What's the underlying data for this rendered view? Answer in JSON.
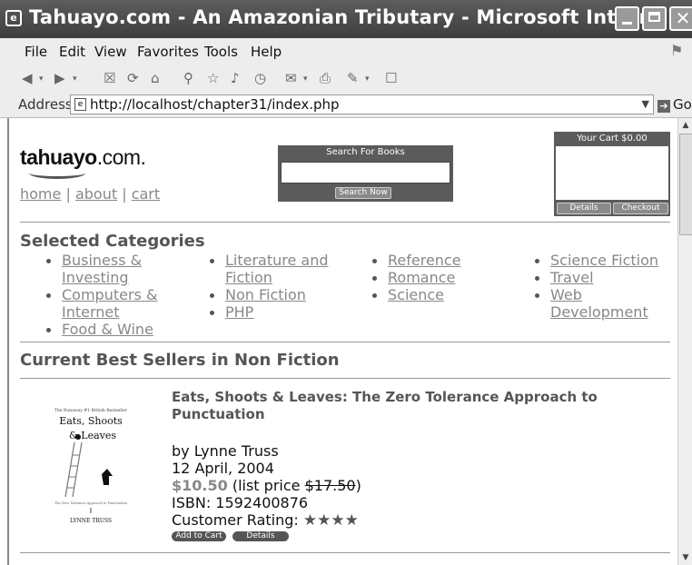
{
  "window": {
    "title": "Tahuayo.com - An Amazonian Tributary - Microsoft Intern..."
  },
  "menu": [
    "File",
    "Edit",
    "View",
    "Favorites",
    "Tools",
    "Help"
  ],
  "address": {
    "label": "Address",
    "url": "http://localhost/chapter31/index.php",
    "go_label": "Go"
  },
  "site": {
    "logo_bold": "tahuayo",
    "logo_rest": ".com.",
    "nav": [
      "home",
      "about",
      "cart"
    ],
    "nav_sep": "|",
    "search": {
      "header": "Search For Books",
      "button": "Search Now",
      "value": ""
    },
    "cart": {
      "header": "Your Cart $0.00",
      "details": "Details",
      "checkout": "Checkout"
    }
  },
  "categories": {
    "heading": "Selected Categories",
    "items": [
      [
        "Business &",
        "Investing"
      ],
      [
        "Computers &",
        "Internet"
      ],
      [
        "Food & Wine"
      ],
      [
        "Literature and",
        "Fiction"
      ],
      [
        "Non Fiction"
      ],
      [
        "PHP"
      ],
      [
        "Reference"
      ],
      [
        "Romance"
      ],
      [
        "Science"
      ],
      [
        "Science Fiction"
      ],
      [
        "Travel"
      ],
      [
        "Web",
        "Development"
      ]
    ]
  },
  "bestsellers": {
    "heading": "Current Best Sellers in Non Fiction",
    "book": {
      "title": "Eats, Shoots & Leaves: The Zero Tolerance Approach to Punctuation",
      "author": "by Lynne Truss",
      "date": "12 April, 2004",
      "price": "$10.50",
      "list_prefix": " (list price ",
      "list_price": "$17.50",
      "list_suffix": ")",
      "isbn": "ISBN: 1592400876",
      "rating_label": "Customer Rating: ",
      "rating_stars": 4,
      "rating_glyphs": "★★★★",
      "add_to_cart": "Add to Cart",
      "details": "Details",
      "cover": {
        "top": "The Runaway #1 British Bestseller",
        "title_line1": "Eats, Shoots",
        "title_line2": "& Leaves",
        "subtitle": "The Zero Tolerance Approach to Punctuation",
        "author": "LYNNE TRUSS"
      }
    }
  }
}
